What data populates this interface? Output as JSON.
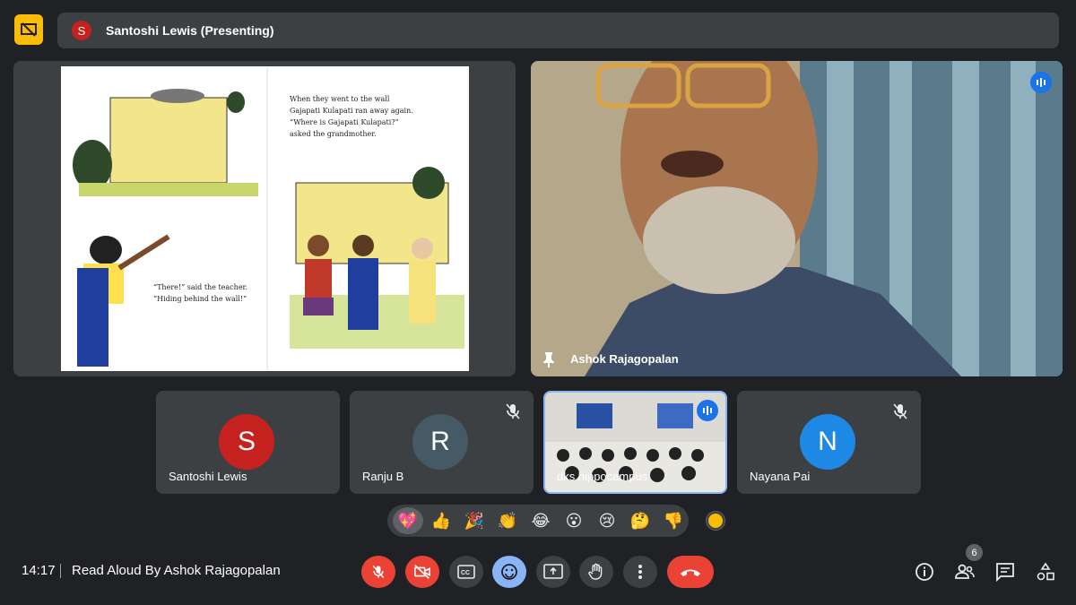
{
  "presenter_bar": {
    "avatar_letter": "S",
    "text": "Santoshi Lewis (Presenting)"
  },
  "book": {
    "text_top": [
      "When they went to the wall",
      "Gajapati Kulapati ran away again.",
      "“Where is Gajapati Kulapati?”",
      "asked the grandmother."
    ],
    "text_bottom": [
      "“There!” said the teacher.",
      "“Hiding behind the wall!”"
    ]
  },
  "speaker": {
    "name": "Ashok Rajagopalan"
  },
  "participants": [
    {
      "name": "Santoshi Lewis",
      "letter": "S",
      "color": "#c5221f",
      "muted": false
    },
    {
      "name": "Ranju B",
      "letter": "R",
      "color": "#455a64",
      "muted": true
    },
    {
      "name": "dks hippocampus",
      "letter": "",
      "color": "",
      "muted": false,
      "video": true
    },
    {
      "name": "Nayana Pai",
      "letter": "N",
      "color": "#1e88e5",
      "muted": true
    }
  ],
  "reactions": [
    "💖",
    "👍",
    "🎉",
    "👏",
    "😂",
    "😮",
    "😢",
    "🤔",
    "👎"
  ],
  "footer": {
    "time": "14:17",
    "meeting_title": "Read Aloud By Ashok Rajagopalan",
    "participant_count": "6"
  },
  "colors": {
    "background": "#202124",
    "surface": "#3c4043",
    "danger": "#ea4335",
    "accent": "#8ab4f8",
    "presenting": "#fbbc04"
  }
}
